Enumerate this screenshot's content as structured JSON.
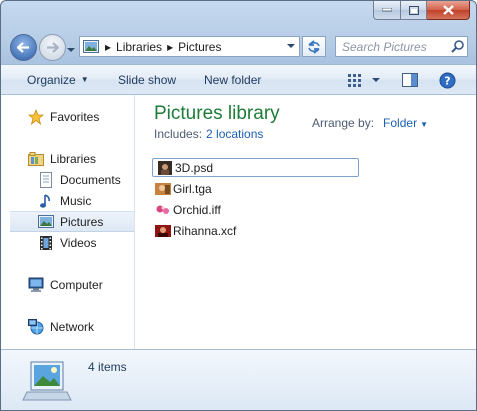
{
  "window": {
    "caption_buttons": [
      "minimize",
      "maximize",
      "close"
    ]
  },
  "address": {
    "crumbs": [
      "Libraries",
      "Pictures"
    ],
    "separator": "▸"
  },
  "search": {
    "placeholder": "Search Pictures"
  },
  "toolbar": {
    "organize_label": "Organize",
    "slideshow_label": "Slide show",
    "newfolder_label": "New folder"
  },
  "nav": {
    "favorites_label": "Favorites",
    "libraries_label": "Libraries",
    "libraries": [
      {
        "label": "Documents"
      },
      {
        "label": "Music"
      },
      {
        "label": "Pictures"
      },
      {
        "label": "Videos"
      }
    ],
    "computer_label": "Computer",
    "network_label": "Network"
  },
  "library": {
    "title": "Pictures library",
    "includes_label": "Includes:",
    "locations_link": "2 locations",
    "arrange_label": "Arrange by:",
    "arrange_value": "Folder"
  },
  "files": [
    {
      "name": "3D.psd"
    },
    {
      "name": "Girl.tga"
    },
    {
      "name": "Orchid.iff"
    },
    {
      "name": "Rihanna.xcf"
    }
  ],
  "status": {
    "item_count": "4 items"
  },
  "colors": {
    "accent_title": "#1e7b3a",
    "link": "#1a5fb4"
  }
}
